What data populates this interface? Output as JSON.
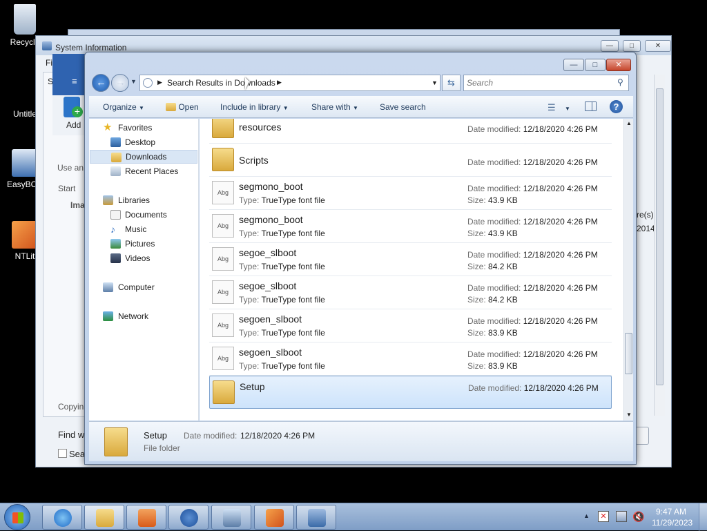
{
  "desktop": {
    "icons": [
      {
        "label": "Recycle"
      },
      {
        "label": "Untitle"
      },
      {
        "label": "EasyBCD"
      },
      {
        "label": "NTLit"
      }
    ]
  },
  "sysinfo": {
    "title": "System Information",
    "menu_fragment": "Fi",
    "add_label": "Add",
    "use_an": "Use an",
    "start": "Start",
    "ima": "Ima",
    "copying": "Copyin",
    "find_what": "Find wh",
    "search_checkbox": "Sear",
    "right_fragments": [
      "re(s)",
      "2014"
    ]
  },
  "explorer": {
    "address_path": "Search Results in Downloads",
    "search_placeholder": "Search",
    "toolbar": {
      "organize": "Organize",
      "open": "Open",
      "include_in_library": "Include in library",
      "share_with": "Share with",
      "save_search": "Save search"
    },
    "nav": {
      "favorites": "Favorites",
      "desktop": "Desktop",
      "downloads": "Downloads",
      "recent_places": "Recent Places",
      "libraries": "Libraries",
      "documents": "Documents",
      "music": "Music",
      "pictures": "Pictures",
      "videos": "Videos",
      "computer": "Computer",
      "network": "Network"
    },
    "labels": {
      "date_modified": "Date modified:",
      "type": "Type:",
      "size": "Size:"
    },
    "files": [
      {
        "name": "resources",
        "kind": "folder",
        "date": "12/18/2020 4:26 PM"
      },
      {
        "name": "Scripts",
        "kind": "folder",
        "date": "12/18/2020 4:26 PM"
      },
      {
        "name": "segmono_boot",
        "kind": "font",
        "type": "TrueType font file",
        "date": "12/18/2020 4:26 PM",
        "size": "43.9 KB"
      },
      {
        "name": "segmono_boot",
        "kind": "font",
        "type": "TrueType font file",
        "date": "12/18/2020 4:26 PM",
        "size": "43.9 KB"
      },
      {
        "name": "segoe_slboot",
        "kind": "font",
        "type": "TrueType font file",
        "date": "12/18/2020 4:26 PM",
        "size": "84.2 KB"
      },
      {
        "name": "segoe_slboot",
        "kind": "font",
        "type": "TrueType font file",
        "date": "12/18/2020 4:26 PM",
        "size": "84.2 KB"
      },
      {
        "name": "segoen_slboot",
        "kind": "font",
        "type": "TrueType font file",
        "date": "12/18/2020 4:26 PM",
        "size": "83.9 KB"
      },
      {
        "name": "segoen_slboot",
        "kind": "font",
        "type": "TrueType font file",
        "date": "12/18/2020 4:26 PM",
        "size": "83.9 KB"
      },
      {
        "name": "Setup",
        "kind": "folder",
        "date": "12/18/2020 4:26 PM",
        "selected": true
      }
    ],
    "details": {
      "name": "Setup",
      "date_label": "Date modified:",
      "date": "12/18/2020 4:26 PM",
      "type": "File folder"
    },
    "font_icon_text": "Abg"
  },
  "taskbar": {
    "time": "9:47 AM",
    "date": "11/29/2023"
  },
  "colors": {
    "accent": "#3a6ea5",
    "selection": "#cde3fb"
  }
}
